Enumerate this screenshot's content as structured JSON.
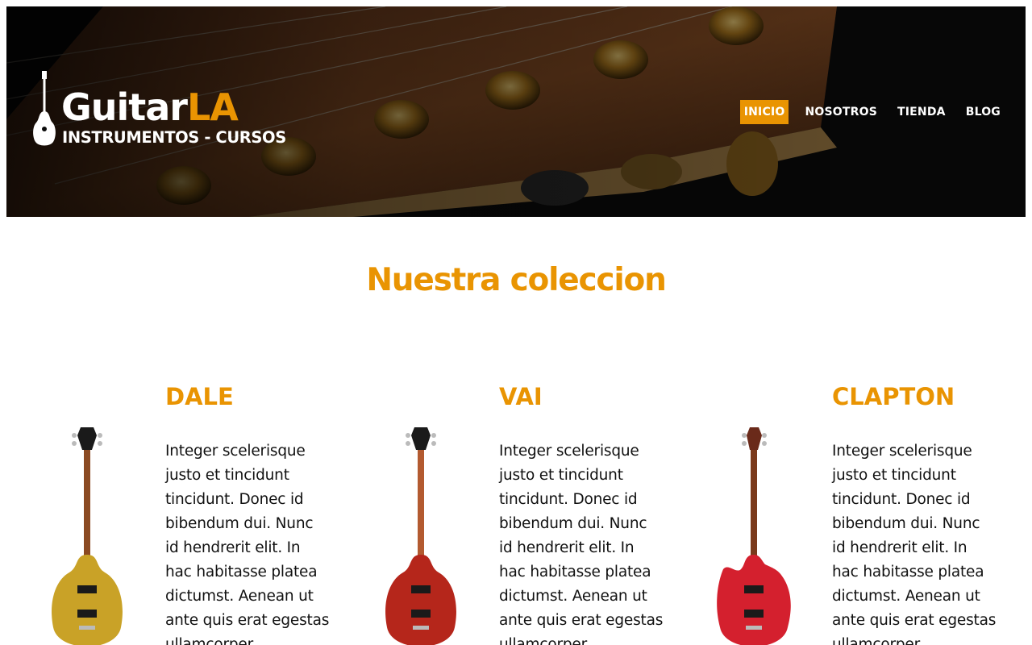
{
  "header": {
    "logo": {
      "brand_main": "Guitar",
      "brand_accent": "LA",
      "tagline": "INSTRUMENTOS - CURSOS"
    },
    "nav": [
      {
        "label": "INICIO",
        "active": true
      },
      {
        "label": "NOSOTROS",
        "active": false
      },
      {
        "label": "TIENDA",
        "active": false
      },
      {
        "label": "BLOG",
        "active": false
      }
    ]
  },
  "main": {
    "title": "Nuestra coleccion",
    "products": [
      {
        "name": "DALE",
        "description": "Integer scelerisque justo et tincidunt tincidunt. Donec id bibendum dui. Nunc id hendrerit elit. In hac habitasse platea dictumst. Aenean ut ante quis erat egestas ullamcorper.",
        "body_color": "#c9a227"
      },
      {
        "name": "VAI",
        "description": "Integer scelerisque justo et tincidunt tincidunt. Donec id bibendum dui. Nunc id hendrerit elit. In hac habitasse platea dictumst. Aenean ut ante quis erat egestas ullamcorper.",
        "body_color": "#b5261b"
      },
      {
        "name": "CLAPTON",
        "description": "Integer scelerisque justo et tincidunt tincidunt. Donec id bibendum dui. Nunc id hendrerit elit. In hac habitasse platea dictumst. Aenean ut ante quis erat egestas ullamcorper.",
        "body_color": "#d4202e"
      }
    ]
  },
  "colors": {
    "accent": "#e99402",
    "header_bg": "#0a0a0a",
    "text": "#111111"
  }
}
